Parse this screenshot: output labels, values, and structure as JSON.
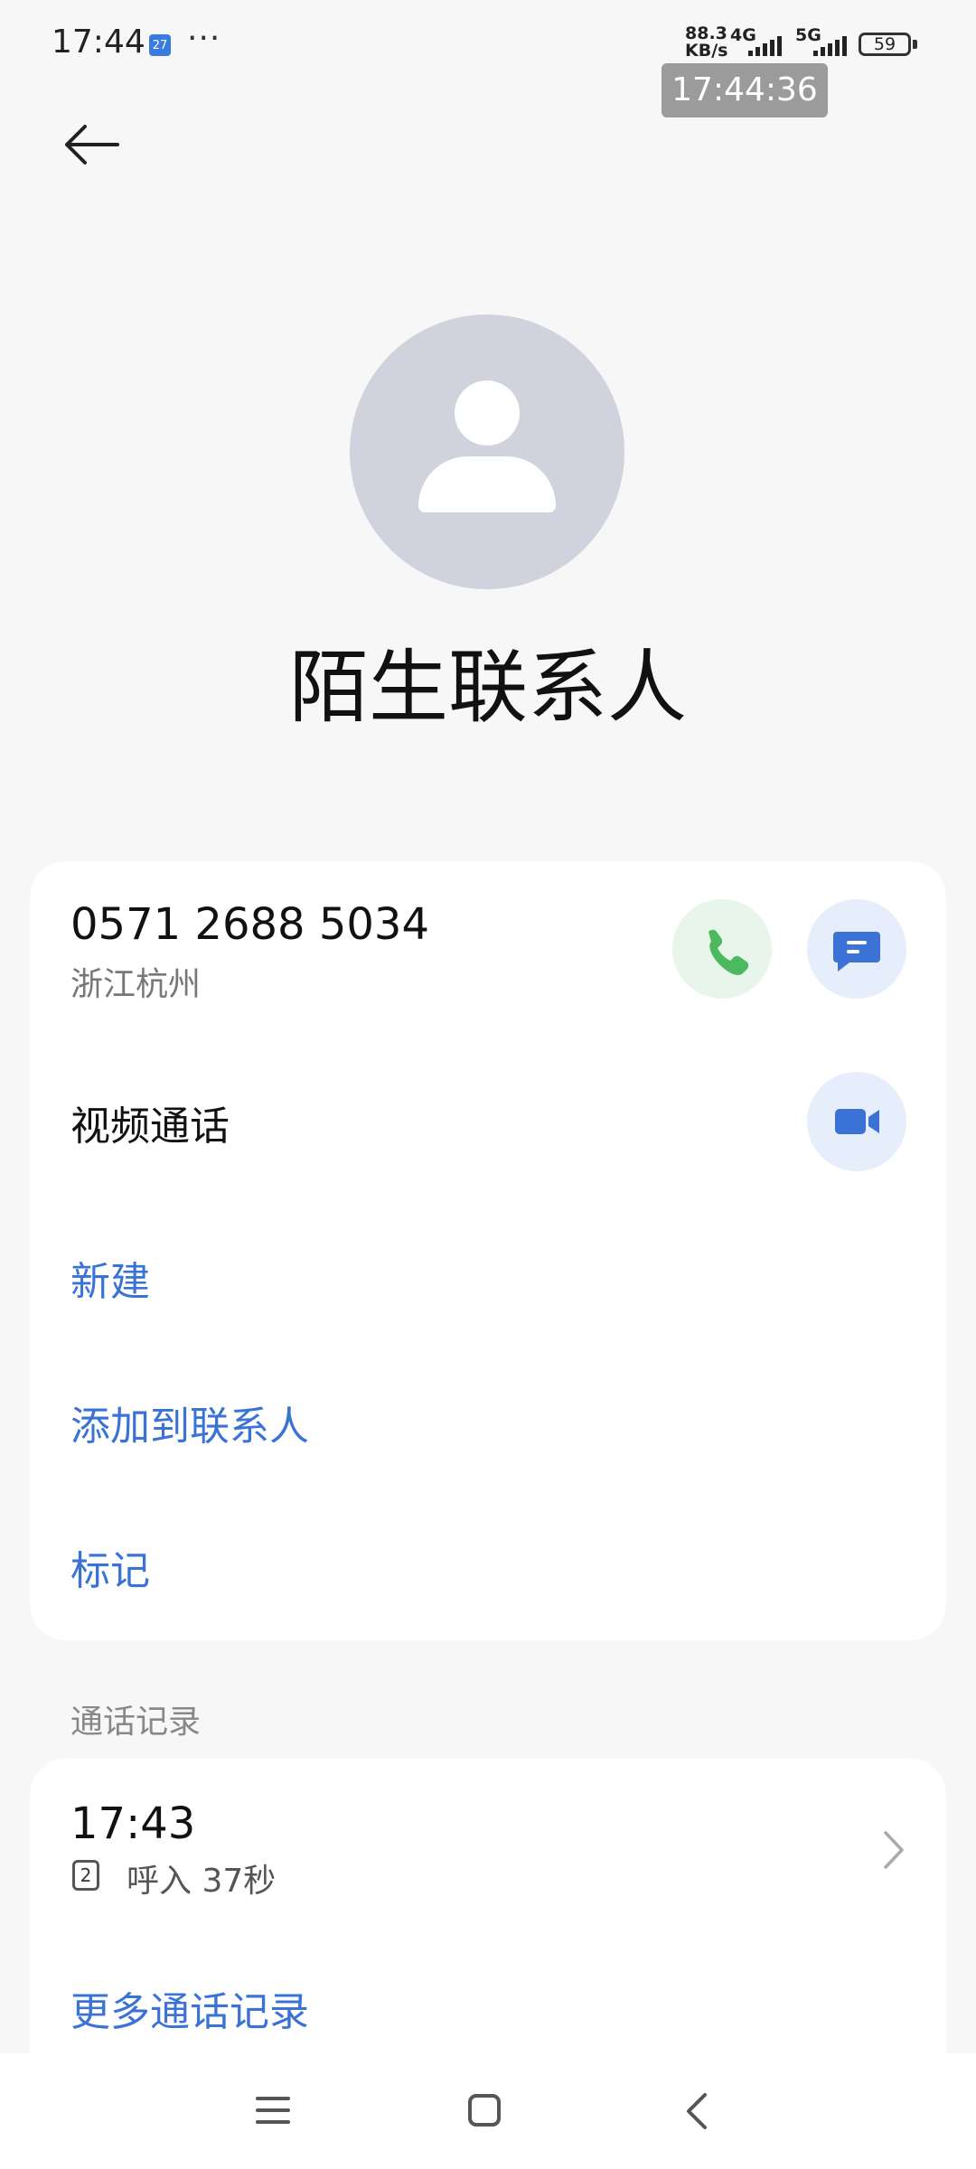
{
  "status_bar": {
    "time": "17:44",
    "calendar_day": "27",
    "more": "···",
    "net_speed_value": "88.3",
    "net_speed_unit": "KB/s",
    "sim1_type": "4G",
    "sim2_type": "5G",
    "battery": "59"
  },
  "clock_overlay": "17:44:36",
  "contact": {
    "name": "陌生联系人",
    "phone": "0571 2688 5034",
    "location": "浙江杭州"
  },
  "actions": {
    "video_call": "视频通话",
    "new": "新建",
    "add_to_contacts": "添加到联系人",
    "mark": "标记"
  },
  "call_log": {
    "section_title": "通话记录",
    "entries": [
      {
        "time": "17:43",
        "sim": "2",
        "detail": "呼入 37秒"
      }
    ],
    "more": "更多通话记录"
  },
  "colors": {
    "accent": "#3a73d5",
    "call_green": "#4cb860",
    "message_blue": "#3a73d5",
    "avatar_bg": "#d0d2dd"
  },
  "icons": [
    "back-arrow-icon",
    "person-icon",
    "phone-icon",
    "message-icon",
    "video-camera-icon",
    "sim-card-icon",
    "chevron-right-icon",
    "menu-icon",
    "home-icon",
    "back-nav-icon"
  ]
}
